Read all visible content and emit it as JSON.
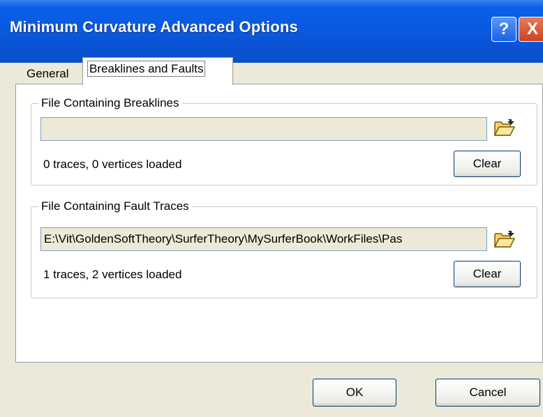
{
  "window": {
    "title": "Minimum Curvature Advanced Options",
    "help_label": "?",
    "close_label": "X"
  },
  "tabs": [
    {
      "label": "General",
      "active": false
    },
    {
      "label": "Breaklines and Faults",
      "active": true
    }
  ],
  "breaklines": {
    "group_label": "File Containing Breaklines",
    "file_path": "",
    "status": "0 traces, 0 vertices loaded",
    "clear_label": "Clear"
  },
  "faults": {
    "group_label": "File Containing Fault Traces",
    "file_path": "E:\\Vit\\GoldenSoftTheory\\SurferTheory\\MySurferBook\\WorkFiles\\Pas",
    "status": "1 traces, 2 vertices loaded",
    "clear_label": "Clear"
  },
  "footer": {
    "ok_label": "OK",
    "cancel_label": "Cancel"
  },
  "colors": {
    "titlebar": "#0A58DC",
    "dialog_bg": "#ECE9D8",
    "close_button": "#C8451F"
  },
  "icons": {
    "browse": "open-folder-icon"
  }
}
